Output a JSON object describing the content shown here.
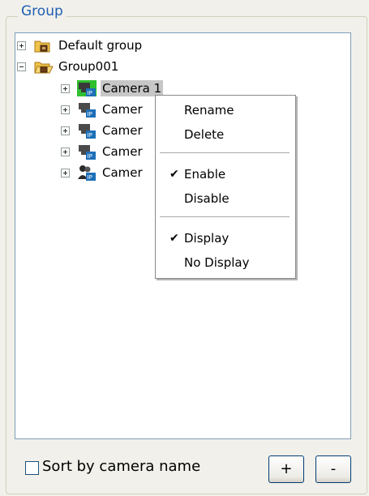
{
  "group": {
    "title": "Group",
    "nodes": [
      {
        "label": "Default group",
        "icon": "folder-icon",
        "expander": "+"
      },
      {
        "label": "Group001",
        "icon": "folder-open-icon",
        "expander": "-"
      },
      {
        "label": "Camera 1",
        "icon": "ip-camera-active-icon",
        "expander": "+"
      },
      {
        "label": "Camer",
        "icon": "ip-camera-icon",
        "expander": "+"
      },
      {
        "label": "Camer",
        "icon": "ip-camera-icon",
        "expander": "+"
      },
      {
        "label": "Camer",
        "icon": "ip-camera-icon",
        "expander": "+"
      },
      {
        "label": "Camer",
        "icon": "ip-camera-person-icon",
        "expander": "+"
      }
    ]
  },
  "context_menu": {
    "items": [
      {
        "label": "Rename",
        "checked": false
      },
      {
        "label": "Delete",
        "checked": false
      },
      {
        "label": "Enable",
        "checked": true
      },
      {
        "label": "Disable",
        "checked": false
      },
      {
        "label": "Display",
        "checked": true
      },
      {
        "label": "No Display",
        "checked": false
      }
    ],
    "check_glyph": "✔"
  },
  "footer": {
    "sort_label": "Sort by camera name",
    "sort_checked": false,
    "add_label": "+",
    "remove_label": "-"
  },
  "colors": {
    "legend": "#1f5fb3",
    "selection": "#c7c7c7",
    "camera_active": "#2fbf2f"
  }
}
